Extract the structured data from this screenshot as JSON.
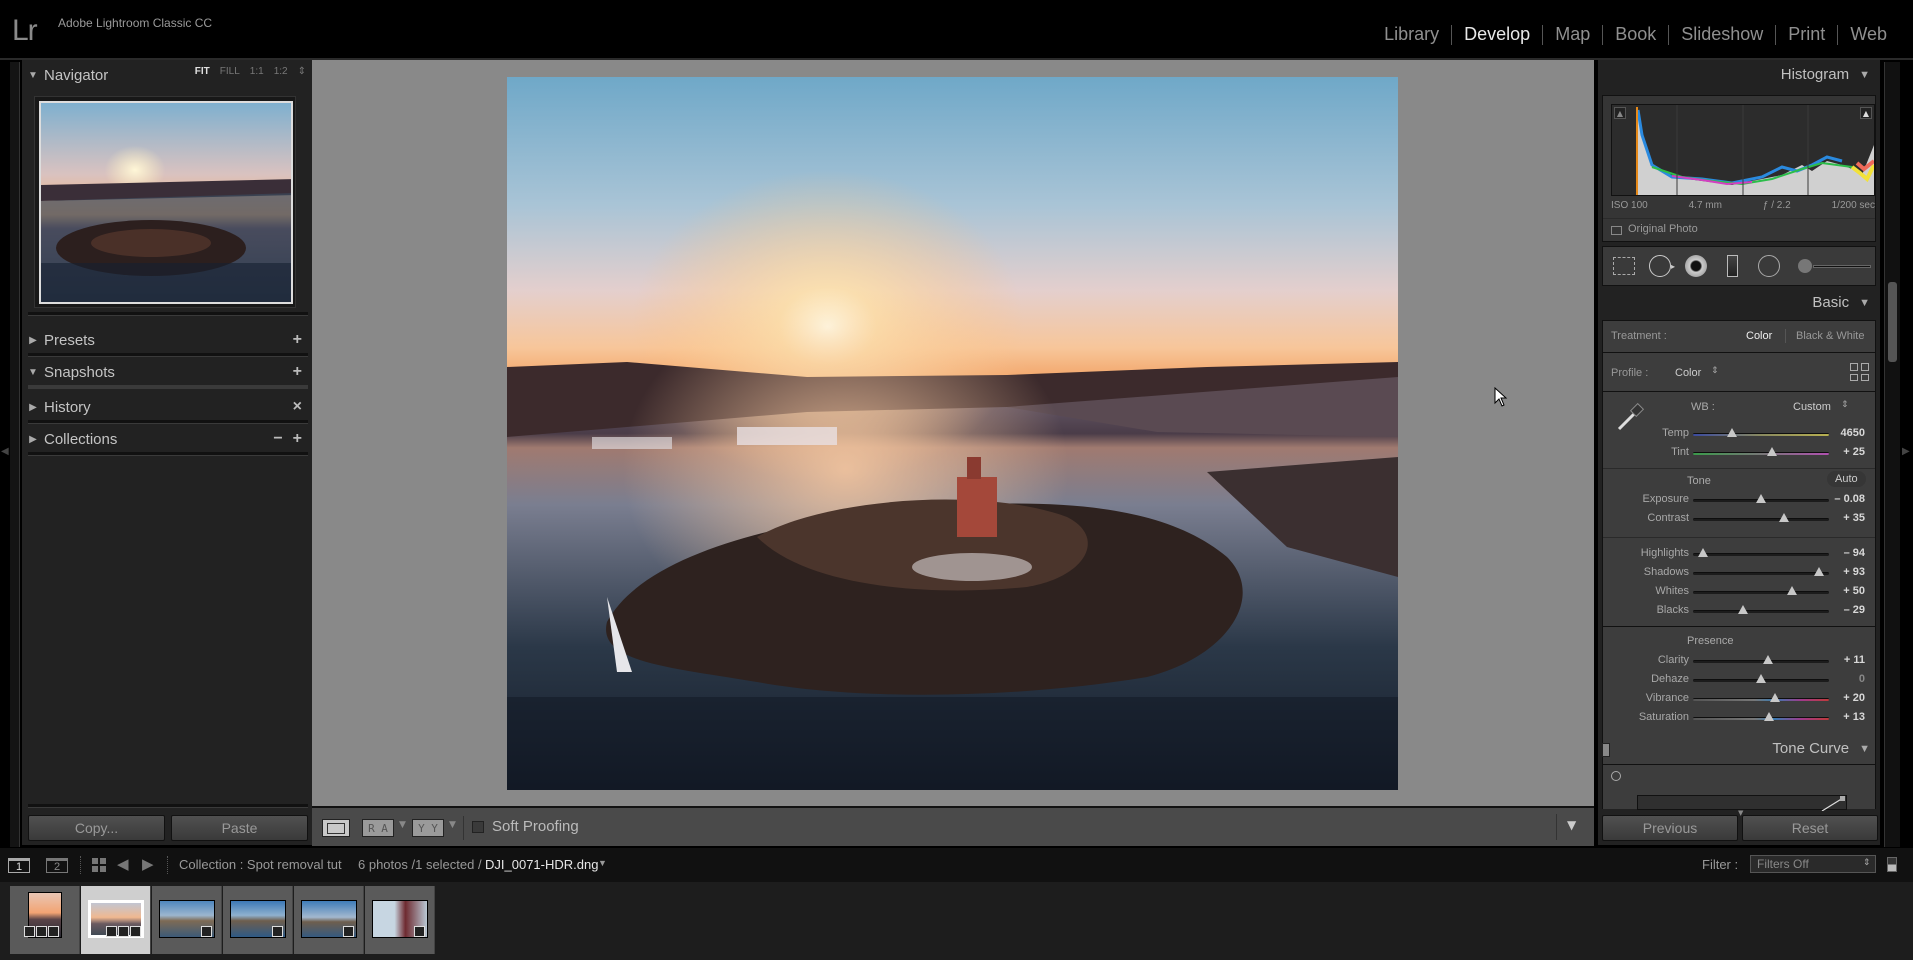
{
  "app": {
    "logo": "Lr",
    "title": "Adobe Lightroom Classic CC"
  },
  "modules": [
    {
      "label": "Library",
      "active": false
    },
    {
      "label": "Develop",
      "active": true
    },
    {
      "label": "Map",
      "active": false
    },
    {
      "label": "Book",
      "active": false
    },
    {
      "label": "Slideshow",
      "active": false
    },
    {
      "label": "Print",
      "active": false
    },
    {
      "label": "Web",
      "active": false
    }
  ],
  "left": {
    "navigator": {
      "title": "Navigator",
      "zoom_options": [
        "FIT",
        "FILL",
        "1:1",
        "1:2"
      ],
      "active_zoom": "FIT"
    },
    "panels": [
      {
        "title": "Presets",
        "expanded": false,
        "actions": [
          "+"
        ]
      },
      {
        "title": "Snapshots",
        "expanded": true,
        "actions": [
          "+"
        ]
      },
      {
        "title": "History",
        "expanded": false,
        "actions": [
          "×"
        ]
      },
      {
        "title": "Collections",
        "expanded": false,
        "actions": [
          "−",
          "+"
        ]
      }
    ],
    "copy_label": "Copy...",
    "paste_label": "Paste"
  },
  "toolbar": {
    "view_compare_label": "R A",
    "before_after_label": "Y Y",
    "soft_proofing_label": "Soft Proofing",
    "soft_proofing_checked": false
  },
  "right": {
    "histogram": {
      "title": "Histogram",
      "iso": "ISO 100",
      "focal": "4.7 mm",
      "aperture": "ƒ / 2.2",
      "shutter": "1/200 sec",
      "original_photo_label": "Original Photo"
    },
    "basic": {
      "title": "Basic",
      "treatment_label": "Treatment :",
      "treatment_color": "Color",
      "treatment_bw": "Black & White",
      "profile_label": "Profile :",
      "profile_value": "Color",
      "wb_label": "WB :",
      "wb_value": "Custom",
      "tone_label": "Tone",
      "auto_label": "Auto",
      "presence_label": "Presence",
      "sliders": {
        "wb": [
          {
            "label": "Temp",
            "value": "4650",
            "pos": 0.29
          },
          {
            "label": "Tint",
            "value": "+ 25",
            "pos": 0.58
          }
        ],
        "tone1": [
          {
            "label": "Exposure",
            "value": "– 0.08",
            "pos": 0.5
          },
          {
            "label": "Contrast",
            "value": "+ 35",
            "pos": 0.67
          }
        ],
        "tone2": [
          {
            "label": "Highlights",
            "value": "– 94",
            "pos": 0.07
          },
          {
            "label": "Shadows",
            "value": "+ 93",
            "pos": 0.93
          },
          {
            "label": "Whites",
            "value": "+ 50",
            "pos": 0.73
          },
          {
            "label": "Blacks",
            "value": "– 29",
            "pos": 0.37
          }
        ],
        "presence": [
          {
            "label": "Clarity",
            "value": "+ 11",
            "pos": 0.55
          },
          {
            "label": "Dehaze",
            "value": "0",
            "pos": 0.5
          },
          {
            "label": "Vibrance",
            "value": "+ 20",
            "pos": 0.6
          },
          {
            "label": "Saturation",
            "value": "+ 13",
            "pos": 0.56
          }
        ]
      }
    },
    "tone_curve": {
      "title": "Tone Curve"
    },
    "previous_label": "Previous",
    "reset_label": "Reset"
  },
  "filmstrip_bar": {
    "page1": "1",
    "page2": "2",
    "collection": "Collection : Spot removal tut",
    "count": "6 photos /1 selected /",
    "filename": "DJI_0071-HDR.dng",
    "filter_label": "Filter :",
    "filter_value": "Filters Off"
  },
  "filmstrip": [
    {
      "name": "sunset-portrait",
      "selected": false
    },
    {
      "name": "sunset-landscape",
      "selected": true
    },
    {
      "name": "river-1",
      "selected": false
    },
    {
      "name": "river-2",
      "selected": false
    },
    {
      "name": "river-3",
      "selected": false
    },
    {
      "name": "man-bridge",
      "selected": false
    }
  ]
}
